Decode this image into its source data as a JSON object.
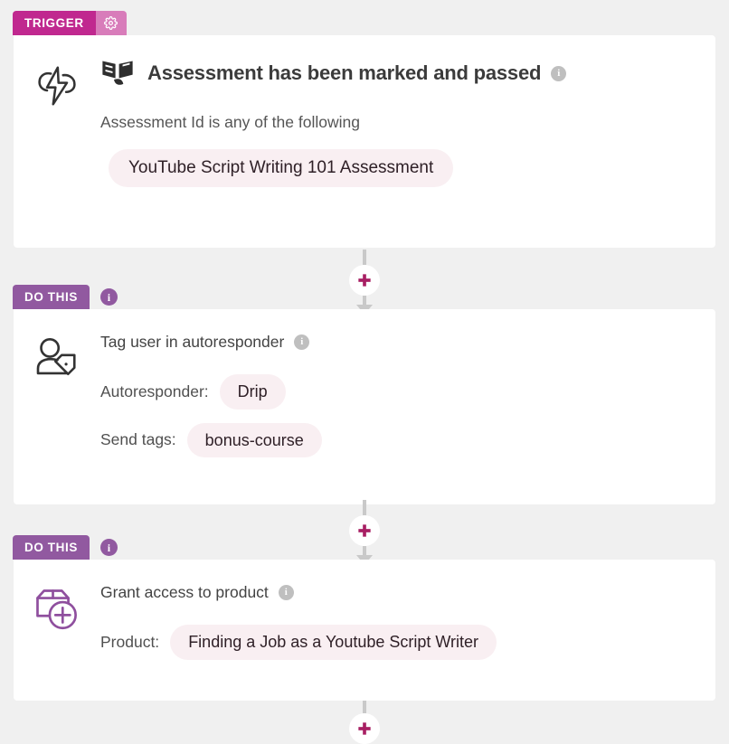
{
  "canvas": {
    "background_color": "#f0f0f0",
    "card_background": "#ffffff",
    "accent_magenta": "#c0288f",
    "accent_purple": "#9159a0",
    "pill_background": "#f9eff2",
    "connector_color": "#c9c9c9"
  },
  "blocks": [
    {
      "badge_label": "TRIGGER",
      "badge_type": "trigger",
      "gear_icon": "gear-icon",
      "main_icon": "cloud-lightning-icon",
      "title_icon": "open-book-leaf-icon",
      "title": "Assessment has been marked and passed",
      "title_info_icon": "info-icon",
      "condition_text": "Assessment Id is any of the following",
      "condition_value": "YouTube Script Writing 101 Assessment"
    },
    {
      "badge_label": "DO THIS",
      "badge_type": "dothis",
      "badge_info_icon": "info-icon",
      "main_icon": "user-tag-icon",
      "title": "Tag user in autoresponder",
      "title_info_icon": "info-icon",
      "fields": [
        {
          "label": "Autoresponder:",
          "value": "Drip"
        },
        {
          "label": "Send tags:",
          "value": "bonus-course"
        }
      ]
    },
    {
      "badge_label": "DO THIS",
      "badge_type": "dothis",
      "badge_info_icon": "info-icon",
      "main_icon": "product-box-plus-icon",
      "title": "Grant access to product",
      "title_info_icon": "info-icon",
      "fields": [
        {
          "label": "Product:",
          "value": "Finding a Job as a Youtube Script Writer"
        }
      ]
    }
  ],
  "connectors": [
    {
      "add_icon": "plus-icon",
      "arrow_icon": "arrow-down-icon"
    },
    {
      "add_icon": "plus-icon",
      "arrow_icon": "arrow-down-icon"
    },
    {
      "add_icon": "plus-icon",
      "arrow_icon": "arrow-down-icon"
    }
  ]
}
